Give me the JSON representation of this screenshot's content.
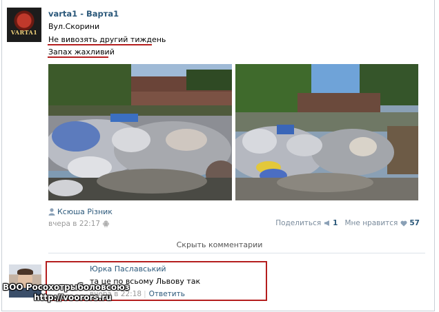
{
  "post": {
    "author": "varta1 - Варта1",
    "avatar_text": "VARTA1",
    "lines": [
      "Вул.Скорини",
      "Не вивозять другий тиждень",
      "Запах жахливий"
    ],
    "signer": "Ксюша Різник",
    "time": "вчера в 22:17",
    "share_label": "Поделиться",
    "share_count": "1",
    "like_label": "Мне нравится",
    "like_count": "57"
  },
  "comments": {
    "toggle_label": "Скрыть комментарии",
    "items": [
      {
        "author": "Юрка Паславський",
        "text": "та це по всьому Львову так",
        "time": "вчера в 22:18",
        "reply_label": "Ответить"
      }
    ]
  },
  "watermark": {
    "line1": "ВОО Росохотрыболовсоюз",
    "line2": "http://voorors.ru"
  },
  "colors": {
    "link": "#2b587a",
    "highlight": "#b41d1d",
    "muted": "#999999"
  }
}
